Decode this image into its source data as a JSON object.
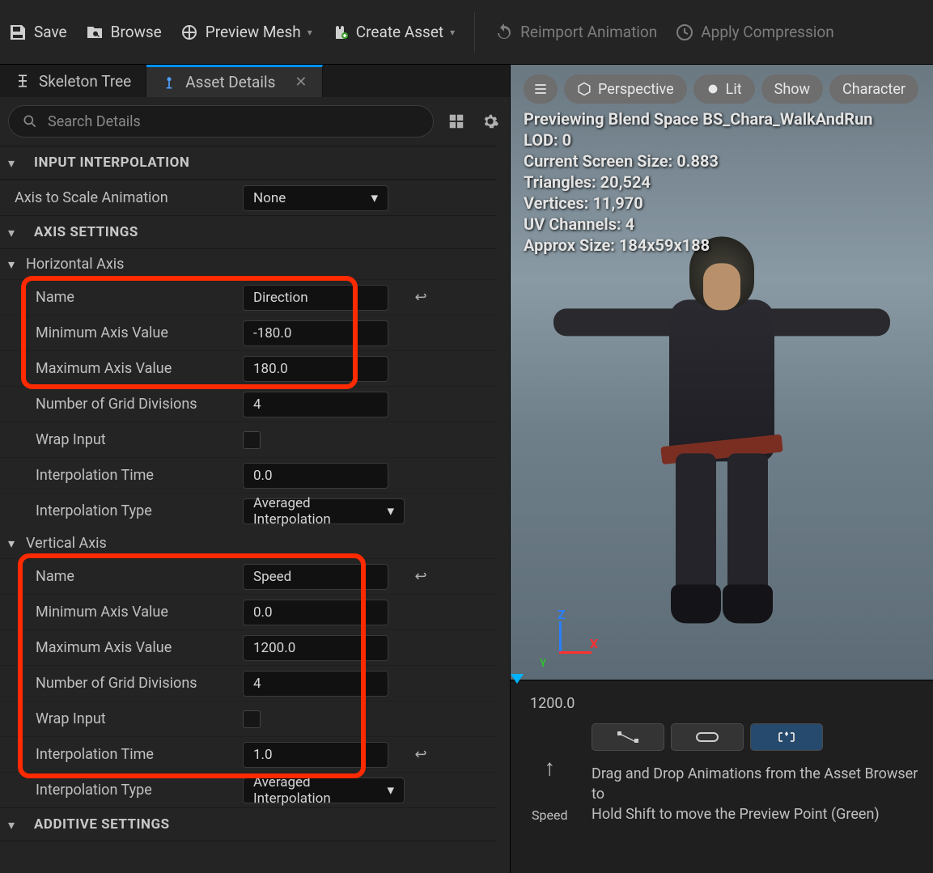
{
  "toolbar": {
    "save": "Save",
    "browse": "Browse",
    "preview_mesh": "Preview Mesh",
    "create_asset": "Create Asset",
    "reimport": "Reimport Animation",
    "apply_compression": "Apply Compression"
  },
  "tabs": {
    "skeleton_tree": "Skeleton Tree",
    "asset_details": "Asset Details"
  },
  "search": {
    "placeholder": "Search Details"
  },
  "sections": {
    "input_interpolation": "INPUT INTERPOLATION",
    "axis_to_scale": {
      "label": "Axis to Scale Animation",
      "value": "None"
    },
    "axis_settings": "AXIS SETTINGS",
    "additive_settings": "ADDITIVE SETTINGS",
    "horizontal": {
      "header": "Horizontal Axis",
      "name_label": "Name",
      "name_value": "Direction",
      "min_label": "Minimum Axis Value",
      "min_value": "-180.0",
      "max_label": "Maximum Axis Value",
      "max_value": "180.0",
      "grid_label": "Number of Grid Divisions",
      "grid_value": "4",
      "wrap_label": "Wrap Input",
      "time_label": "Interpolation Time",
      "time_value": "0.0",
      "type_label": "Interpolation Type",
      "type_value": "Averaged Interpolation"
    },
    "vertical": {
      "header": "Vertical Axis",
      "name_label": "Name",
      "name_value": "Speed",
      "min_label": "Minimum Axis Value",
      "min_value": "0.0",
      "max_label": "Maximum Axis Value",
      "max_value": "1200.0",
      "grid_label": "Number of Grid Divisions",
      "grid_value": "4",
      "wrap_label": "Wrap Input",
      "time_label": "Interpolation Time",
      "time_value": "1.0",
      "type_label": "Interpolation Type",
      "type_value": "Averaged Interpolation"
    }
  },
  "viewport": {
    "menu_btns": {
      "perspective": "Perspective",
      "lit": "Lit",
      "show": "Show",
      "character": "Character"
    },
    "stats": {
      "line1": "Previewing Blend Space BS_Chara_WalkAndRun",
      "lod_label": "LOD:",
      "lod_value": "0",
      "screen_label": "Current Screen Size:",
      "screen_value": "0.883",
      "tri_label": "Triangles:",
      "tri_value": "20,524",
      "vert_label": "Vertices:",
      "vert_value": "11,970",
      "uv_label": "UV Channels:",
      "uv_value": "4",
      "size_label": "Approx Size:",
      "size_value": "184x59x188"
    },
    "gizmo": {
      "x": "X",
      "y": "Y",
      "z": "Z"
    }
  },
  "timeline": {
    "top_value": "1200.0",
    "speed_label": "Speed",
    "hint1": "Drag and Drop Animations from the Asset Browser to",
    "hint2": "Hold Shift to move the Preview Point (Green)"
  }
}
